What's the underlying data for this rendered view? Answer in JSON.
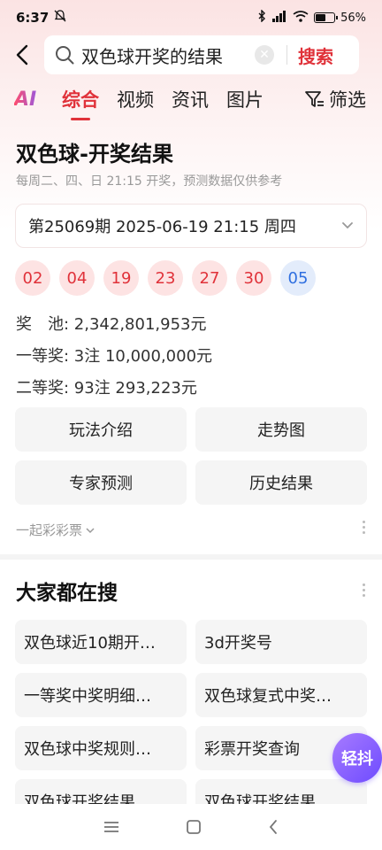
{
  "status_bar": {
    "time": "6:37",
    "battery": "56%",
    "battery_level": 0.56
  },
  "search": {
    "query": "双色球开奖的结果",
    "button": "搜索"
  },
  "tabs": {
    "ai": "AI",
    "items": [
      "综合",
      "视频",
      "资讯",
      "图片"
    ],
    "active": "综合",
    "filter": "筛选"
  },
  "result": {
    "title": "双色球-开奖结果",
    "subtitle": "每周二、四、日 21:15 开奖，预测数据仅供参考",
    "period": "第25069期 2025-06-19 21:15 周四",
    "red_balls": [
      "02",
      "04",
      "19",
      "23",
      "27",
      "30"
    ],
    "blue_ball": "05",
    "jackpot": "奖　池: 2,342,801,953元",
    "first_prize": "一等奖: 3注 10,000,000元",
    "second_prize": "二等奖: 93注 293,223元",
    "buttons": [
      "玩法介绍",
      "走势图",
      "专家预测",
      "历史结果"
    ],
    "source": "一起彩彩票"
  },
  "everyone_searching": {
    "title": "大家都在搜",
    "items": [
      "双色球近10期开…",
      "3d开奖号",
      "一等奖中奖明细…",
      "双色球复式中奖…",
      "双色球中奖规则…",
      "彩票开奖查询",
      "双色球开奖结果",
      "双色球开奖结果"
    ]
  },
  "float_button": "轻抖",
  "colors": {
    "accent": "#e0323a",
    "red_ball_bg": "#fde3e3",
    "blue_ball": "#2f6fe0",
    "float_purple": "#6e4bff"
  }
}
